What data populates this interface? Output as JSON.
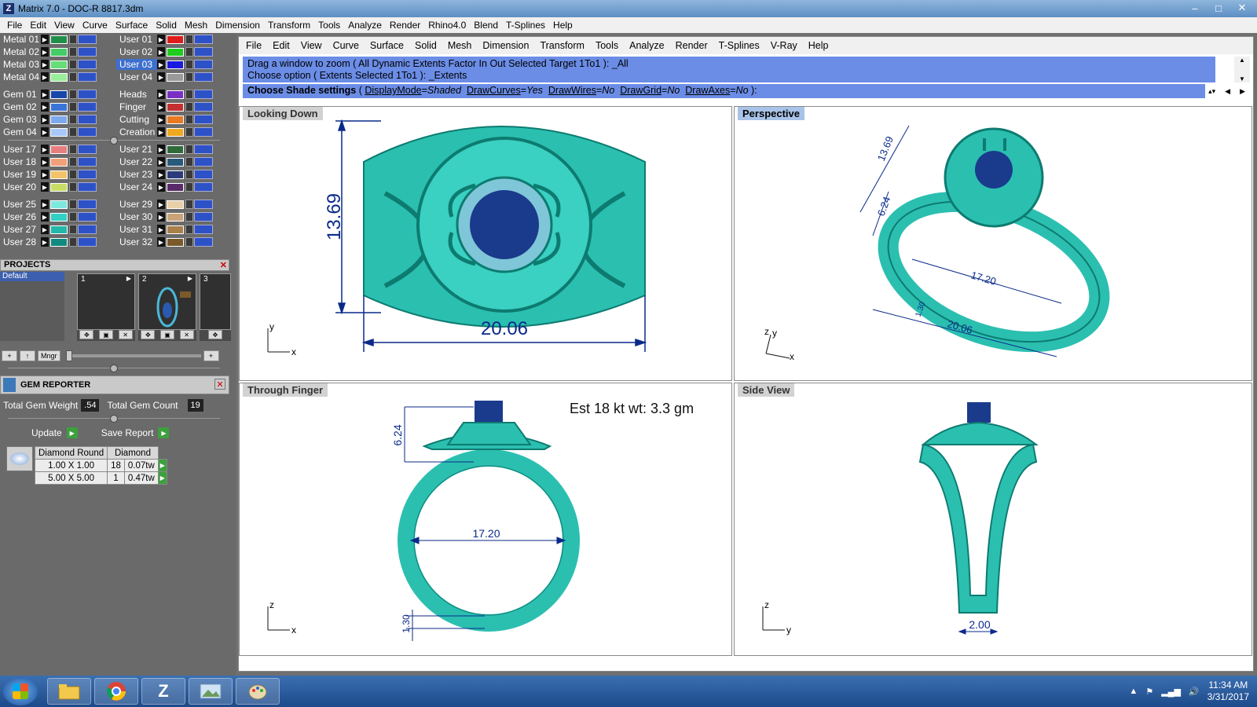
{
  "window": {
    "title": "Matrix 7.0 - DOC-R 8817.3dm",
    "controls": [
      "–",
      "□",
      "✕"
    ]
  },
  "menu": [
    "File",
    "Edit",
    "View",
    "Curve",
    "Surface",
    "Solid",
    "Mesh",
    "Dimension",
    "Transform",
    "Tools",
    "Analyze",
    "Render",
    "Rhino4.0",
    "Blend",
    "T-Splines",
    "Help"
  ],
  "layers": {
    "left": [
      {
        "name": "Metal 01",
        "color": "#1f8f4a"
      },
      {
        "name": "Metal 02",
        "color": "#44cc66"
      },
      {
        "name": "Metal 03",
        "color": "#66dd77"
      },
      {
        "name": "Metal 04",
        "color": "#99ee99"
      },
      {
        "name": "Gem 01",
        "color": "#1747a8"
      },
      {
        "name": "Gem 02",
        "color": "#3a74d8"
      },
      {
        "name": "Gem 03",
        "color": "#7ea8ee"
      },
      {
        "name": "Gem 04",
        "color": "#a8c8f8"
      },
      {
        "name": "User 17",
        "color": "#e87d7d"
      },
      {
        "name": "User 18",
        "color": "#f2a07a"
      },
      {
        "name": "User 19",
        "color": "#f2c36a"
      },
      {
        "name": "User 20",
        "color": "#c8dd66"
      },
      {
        "name": "User 25",
        "color": "#7de8dd"
      },
      {
        "name": "User 26",
        "color": "#33d0c4"
      },
      {
        "name": "User 27",
        "color": "#22b8aa"
      },
      {
        "name": "User 28",
        "color": "#118a80"
      }
    ],
    "right": [
      {
        "name": "User 01",
        "color": "#e01b1b",
        "selected": false
      },
      {
        "name": "User 02",
        "color": "#1fcc1f",
        "selected": false
      },
      {
        "name": "User 03",
        "color": "#1a1ae0",
        "selected": true
      },
      {
        "name": "User 04",
        "color": "#9a9a9a",
        "selected": false
      },
      {
        "name": "Heads",
        "color": "#7a2fc4",
        "selected": false
      },
      {
        "name": "Finger",
        "color": "#c42f2f",
        "selected": false
      },
      {
        "name": "Cutting",
        "color": "#e87a22",
        "selected": false
      },
      {
        "name": "Creation",
        "color": "#f0a820",
        "selected": false
      },
      {
        "name": "User 21",
        "color": "#2f6a3a",
        "selected": false
      },
      {
        "name": "User 22",
        "color": "#2a5a7a",
        "selected": false
      },
      {
        "name": "User 23",
        "color": "#2a3a7a",
        "selected": false
      },
      {
        "name": "User 24",
        "color": "#5a2a6a",
        "selected": false
      },
      {
        "name": "User 29",
        "color": "#e8d0a8",
        "selected": false
      },
      {
        "name": "User 30",
        "color": "#c8a478",
        "selected": false
      },
      {
        "name": "User 31",
        "color": "#a8804a",
        "selected": false
      },
      {
        "name": "User 32",
        "color": "#7a5a2a",
        "selected": false
      }
    ]
  },
  "projects": {
    "header": "PROJECTS",
    "close": "✕",
    "list": [
      "Default"
    ],
    "thumbs": [
      "1",
      "2",
      "3"
    ],
    "tools": [
      "+",
      "↑",
      "Mngr",
      "+"
    ]
  },
  "gem_reporter": {
    "title": "GEM REPORTER",
    "close": "✕",
    "total_weight_label": "Total Gem Weight",
    "total_weight": ".54",
    "total_count_label": "Total Gem Count",
    "total_count": "19",
    "update": "Update",
    "save_report": "Save Report",
    "columns": [
      "Diamond Round",
      "Diamond"
    ],
    "rows": [
      {
        "size": "1.00 X 1.00",
        "count": "18",
        "weight": "0.07tw"
      },
      {
        "size": "5.00 X 5.00",
        "count": "1",
        "weight": "0.47tw"
      }
    ]
  },
  "doc_menu": [
    "File",
    "Edit",
    "View",
    "Curve",
    "Surface",
    "Solid",
    "Mesh",
    "Dimension",
    "Transform",
    "Tools",
    "Analyze",
    "Render",
    "T-Splines",
    "V-Ray",
    "Help"
  ],
  "command_history": [
    "Drag a window to zoom ( All  Dynamic  Extents  Factor  In  Out  Selected  Target  1To1 ): _All",
    "Choose option ( Extents  Selected  1To1 ): _Extents"
  ],
  "prompt": {
    "label": "Choose Shade settings",
    "open": " ( ",
    "opt1": "DisplayMode",
    "val1": "Shaded",
    "opt2": "DrawCurves",
    "val2": "Yes",
    "opt3": "DrawWires",
    "val3": "No",
    "opt4": "DrawGrid",
    "val4": "No",
    "opt5": "DrawAxes",
    "val5": "No",
    "close": " ):"
  },
  "viewports": {
    "top": {
      "label": "Looking Down",
      "dim_h": "13.69",
      "dim_w": "20.06",
      "ax1": "y",
      "ax2": "x"
    },
    "perspective": {
      "label": "Perspective",
      "d1": "13.69",
      "d2": "6.24",
      "d3": "17.20",
      "d4": "20.06",
      "d5": "1.30",
      "ax1": "z",
      "ax2": "y",
      "ax3": "x"
    },
    "front": {
      "label": "Through Finger",
      "weight_text": "Est 18 kt wt: 3.3 gm",
      "d_head": "6.24",
      "d_inner": "17.20",
      "d_shank": "1.30",
      "ax1": "z",
      "ax2": "x"
    },
    "side": {
      "label": "Side View",
      "d_bottom": "2.00",
      "ax1": "z",
      "ax2": "y"
    }
  },
  "taskbar": {
    "time": "11:34 AM",
    "date": "3/31/2017",
    "apps": [
      "file-explorer-icon",
      "chrome-icon",
      "matrix-icon",
      "photos-icon",
      "paint-icon"
    ]
  },
  "colors": {
    "metal": "#2bbfb0",
    "gem": "#1a3a8c",
    "accent_cmd": "#6b8de6",
    "dimension": "#0a2a8a"
  }
}
